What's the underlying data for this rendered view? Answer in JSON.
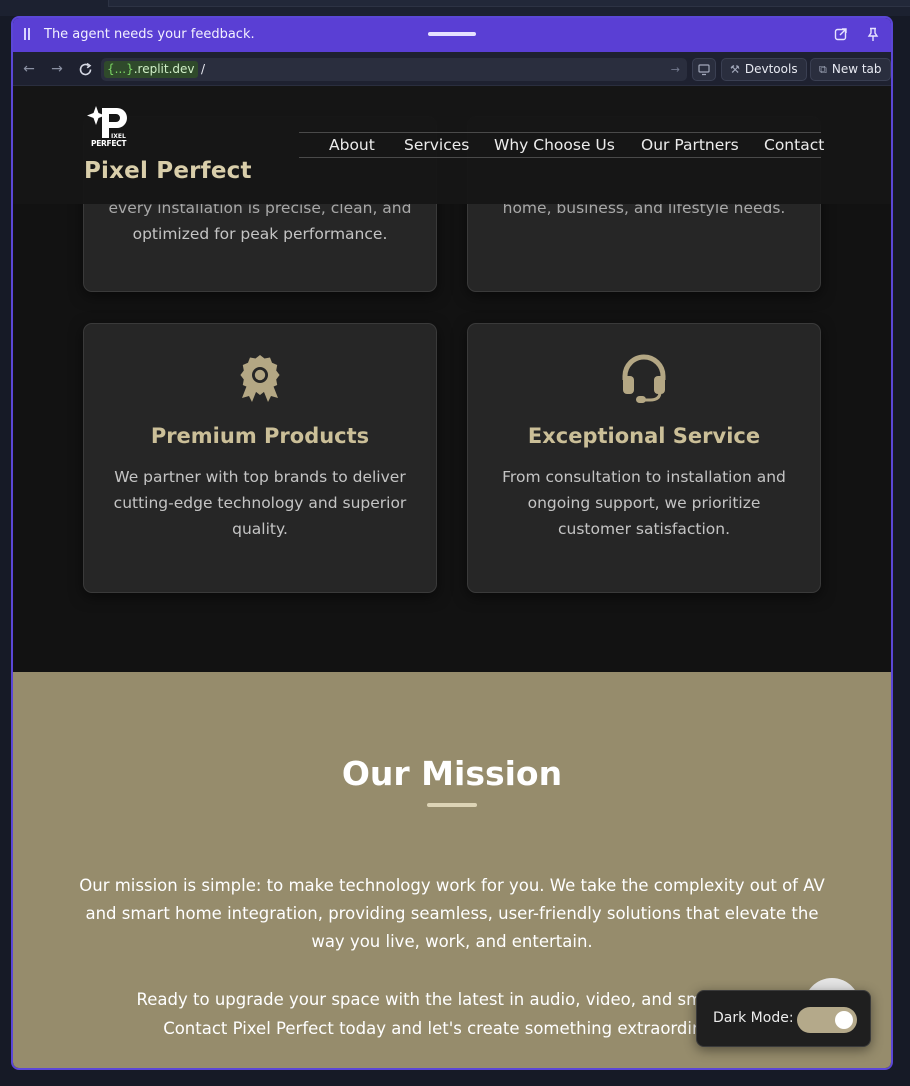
{
  "banner": {
    "message": "The agent needs your feedback."
  },
  "browser": {
    "host_placeholder": "{...}",
    "host_domain": ".replit.dev",
    "path": "/",
    "devtools_label": "Devtools",
    "newtab_label": "New tab"
  },
  "site": {
    "brand": "Pixel Perfect",
    "logo_text": "PIXEL PERFECT",
    "nav": [
      "About",
      "Services",
      "Why Choose Us",
      "Our Partners",
      "Contact"
    ],
    "cards_top": [
      {
        "faded_line1": "every installation is precise, clean, and",
        "line2": "optimized for peak performance."
      },
      {
        "faded_line1": "home, business, and lifestyle needs."
      }
    ],
    "cards": [
      {
        "icon": "award-icon",
        "title": "Premium Products",
        "text": "We partner with top brands to deliver cutting-edge technology and superior quality."
      },
      {
        "icon": "headset-icon",
        "title": "Exceptional Service",
        "text": "From consultation to installation and ongoing support, we prioritize customer satisfaction."
      }
    ],
    "mission": {
      "title": "Our Mission",
      "p1": "Our mission is simple: to make technology work for you. We take the complexity out of AV and smart home integration, providing seamless, user-friendly solutions that elevate the way you live, work, and entertain.",
      "p2": "Ready to upgrade your space with the latest in audio, video, and smart hom",
      "p3": "Contact Pixel Perfect today and let's create something extraordinary t"
    },
    "dark_mode": {
      "label": "Dark Mode:",
      "enabled": true
    }
  },
  "colors": {
    "banner": "#5a3fd4",
    "accent_gold": "#cbbf98",
    "mission_bg": "#968c6c"
  }
}
